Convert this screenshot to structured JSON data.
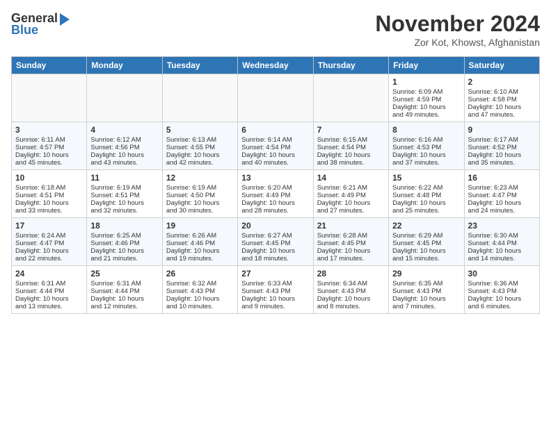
{
  "header": {
    "logo_line1": "General",
    "logo_line2": "Blue",
    "title": "November 2024",
    "subtitle": "Zor Kot, Khowst, Afghanistan"
  },
  "calendar": {
    "days_of_week": [
      "Sunday",
      "Monday",
      "Tuesday",
      "Wednesday",
      "Thursday",
      "Friday",
      "Saturday"
    ],
    "weeks": [
      [
        {
          "day": "",
          "info": ""
        },
        {
          "day": "",
          "info": ""
        },
        {
          "day": "",
          "info": ""
        },
        {
          "day": "",
          "info": ""
        },
        {
          "day": "",
          "info": ""
        },
        {
          "day": "1",
          "info": "Sunrise: 6:09 AM\nSunset: 4:59 PM\nDaylight: 10 hours\nand 49 minutes."
        },
        {
          "day": "2",
          "info": "Sunrise: 6:10 AM\nSunset: 4:58 PM\nDaylight: 10 hours\nand 47 minutes."
        }
      ],
      [
        {
          "day": "3",
          "info": "Sunrise: 6:11 AM\nSunset: 4:57 PM\nDaylight: 10 hours\nand 45 minutes."
        },
        {
          "day": "4",
          "info": "Sunrise: 6:12 AM\nSunset: 4:56 PM\nDaylight: 10 hours\nand 43 minutes."
        },
        {
          "day": "5",
          "info": "Sunrise: 6:13 AM\nSunset: 4:55 PM\nDaylight: 10 hours\nand 42 minutes."
        },
        {
          "day": "6",
          "info": "Sunrise: 6:14 AM\nSunset: 4:54 PM\nDaylight: 10 hours\nand 40 minutes."
        },
        {
          "day": "7",
          "info": "Sunrise: 6:15 AM\nSunset: 4:54 PM\nDaylight: 10 hours\nand 38 minutes."
        },
        {
          "day": "8",
          "info": "Sunrise: 6:16 AM\nSunset: 4:53 PM\nDaylight: 10 hours\nand 37 minutes."
        },
        {
          "day": "9",
          "info": "Sunrise: 6:17 AM\nSunset: 4:52 PM\nDaylight: 10 hours\nand 35 minutes."
        }
      ],
      [
        {
          "day": "10",
          "info": "Sunrise: 6:18 AM\nSunset: 4:51 PM\nDaylight: 10 hours\nand 33 minutes."
        },
        {
          "day": "11",
          "info": "Sunrise: 6:19 AM\nSunset: 4:51 PM\nDaylight: 10 hours\nand 32 minutes."
        },
        {
          "day": "12",
          "info": "Sunrise: 6:19 AM\nSunset: 4:50 PM\nDaylight: 10 hours\nand 30 minutes."
        },
        {
          "day": "13",
          "info": "Sunrise: 6:20 AM\nSunset: 4:49 PM\nDaylight: 10 hours\nand 28 minutes."
        },
        {
          "day": "14",
          "info": "Sunrise: 6:21 AM\nSunset: 4:49 PM\nDaylight: 10 hours\nand 27 minutes."
        },
        {
          "day": "15",
          "info": "Sunrise: 6:22 AM\nSunset: 4:48 PM\nDaylight: 10 hours\nand 25 minutes."
        },
        {
          "day": "16",
          "info": "Sunrise: 6:23 AM\nSunset: 4:47 PM\nDaylight: 10 hours\nand 24 minutes."
        }
      ],
      [
        {
          "day": "17",
          "info": "Sunrise: 6:24 AM\nSunset: 4:47 PM\nDaylight: 10 hours\nand 22 minutes."
        },
        {
          "day": "18",
          "info": "Sunrise: 6:25 AM\nSunset: 4:46 PM\nDaylight: 10 hours\nand 21 minutes."
        },
        {
          "day": "19",
          "info": "Sunrise: 6:26 AM\nSunset: 4:46 PM\nDaylight: 10 hours\nand 19 minutes."
        },
        {
          "day": "20",
          "info": "Sunrise: 6:27 AM\nSunset: 4:45 PM\nDaylight: 10 hours\nand 18 minutes."
        },
        {
          "day": "21",
          "info": "Sunrise: 6:28 AM\nSunset: 4:45 PM\nDaylight: 10 hours\nand 17 minutes."
        },
        {
          "day": "22",
          "info": "Sunrise: 6:29 AM\nSunset: 4:45 PM\nDaylight: 10 hours\nand 15 minutes."
        },
        {
          "day": "23",
          "info": "Sunrise: 6:30 AM\nSunset: 4:44 PM\nDaylight: 10 hours\nand 14 minutes."
        }
      ],
      [
        {
          "day": "24",
          "info": "Sunrise: 6:31 AM\nSunset: 4:44 PM\nDaylight: 10 hours\nand 13 minutes."
        },
        {
          "day": "25",
          "info": "Sunrise: 6:31 AM\nSunset: 4:44 PM\nDaylight: 10 hours\nand 12 minutes."
        },
        {
          "day": "26",
          "info": "Sunrise: 6:32 AM\nSunset: 4:43 PM\nDaylight: 10 hours\nand 10 minutes."
        },
        {
          "day": "27",
          "info": "Sunrise: 6:33 AM\nSunset: 4:43 PM\nDaylight: 10 hours\nand 9 minutes."
        },
        {
          "day": "28",
          "info": "Sunrise: 6:34 AM\nSunset: 4:43 PM\nDaylight: 10 hours\nand 8 minutes."
        },
        {
          "day": "29",
          "info": "Sunrise: 6:35 AM\nSunset: 4:43 PM\nDaylight: 10 hours\nand 7 minutes."
        },
        {
          "day": "30",
          "info": "Sunrise: 6:36 AM\nSunset: 4:43 PM\nDaylight: 10 hours\nand 6 minutes."
        }
      ]
    ]
  }
}
